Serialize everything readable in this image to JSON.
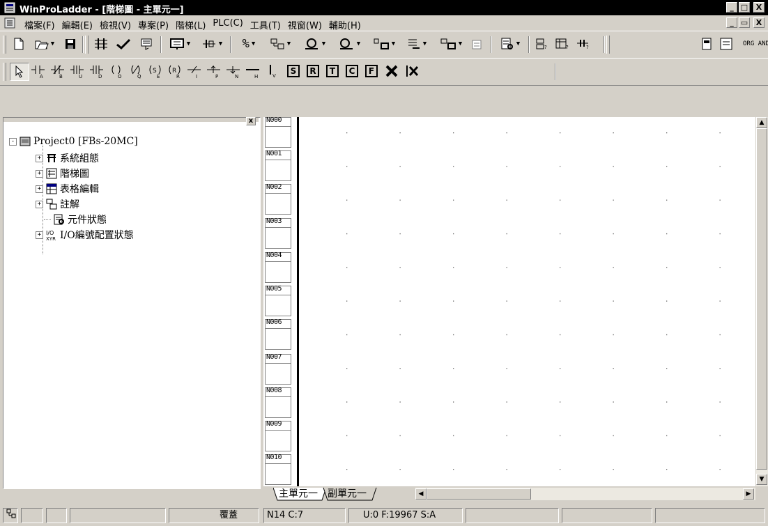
{
  "window": {
    "title": "WinProLadder - [階梯圖 - 主單元一]",
    "caption_buttons": [
      "_",
      "□",
      "X"
    ],
    "mdi_buttons": [
      "_",
      "ð",
      "X"
    ]
  },
  "menu": [
    "檔案(F)",
    "編輯(E)",
    "檢視(V)",
    "專案(P)",
    "階梯(L)",
    "PLC(C)",
    "工具(T)",
    "視窗(W)",
    "輔助(H)"
  ],
  "toolbar2": {
    "contacts": [
      "ᴬ",
      "ᴮ",
      "ᵁ",
      "ᴰ",
      "ᴼ",
      "ᴽ",
      "ᴱ",
      "ᴿ"
    ],
    "boxed": [
      "S",
      "R",
      "T",
      "C",
      "F"
    ],
    "v_label": "V",
    "org_and": "ORG AND"
  },
  "tree": {
    "root": "Project0 [FBs-20MC]",
    "items": [
      "系統組態",
      "階梯圖",
      "表格編輯",
      "註解",
      "元件狀態",
      "I/O編號配置狀態"
    ]
  },
  "rungs": [
    "N000",
    "N001",
    "N002",
    "N003",
    "N004",
    "N005",
    "N006",
    "N007",
    "N008",
    "N009",
    "N010"
  ],
  "tabs": [
    "主單元一",
    "副單元一"
  ],
  "status": {
    "mode": "覆蓋",
    "position": "N14 C:7",
    "info": "U:0 F:19967 S:A"
  }
}
